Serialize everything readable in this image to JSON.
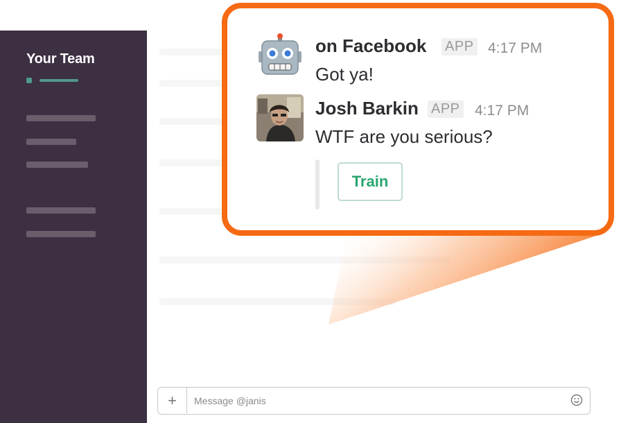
{
  "sidebar": {
    "team_name": "Your Team"
  },
  "messages": [
    {
      "sender": "on Facebook",
      "badge": "APP",
      "time": "4:17 PM",
      "text": "Got ya!",
      "avatar": "robot-avatar"
    },
    {
      "sender": "Josh Barkin",
      "badge": "APP",
      "time": "4:17 PM",
      "text": "WTF are you serious?",
      "avatar": "user-photo-avatar"
    }
  ],
  "attachment": {
    "button_label": "Train"
  },
  "composer": {
    "placeholder": "Message @janis",
    "plus_icon": "plus-icon",
    "emoji_icon": "smiley-icon"
  },
  "colors": {
    "sidebar": "#3d3042",
    "callout_border": "#f56a12",
    "train_text": "#2aa56e"
  }
}
